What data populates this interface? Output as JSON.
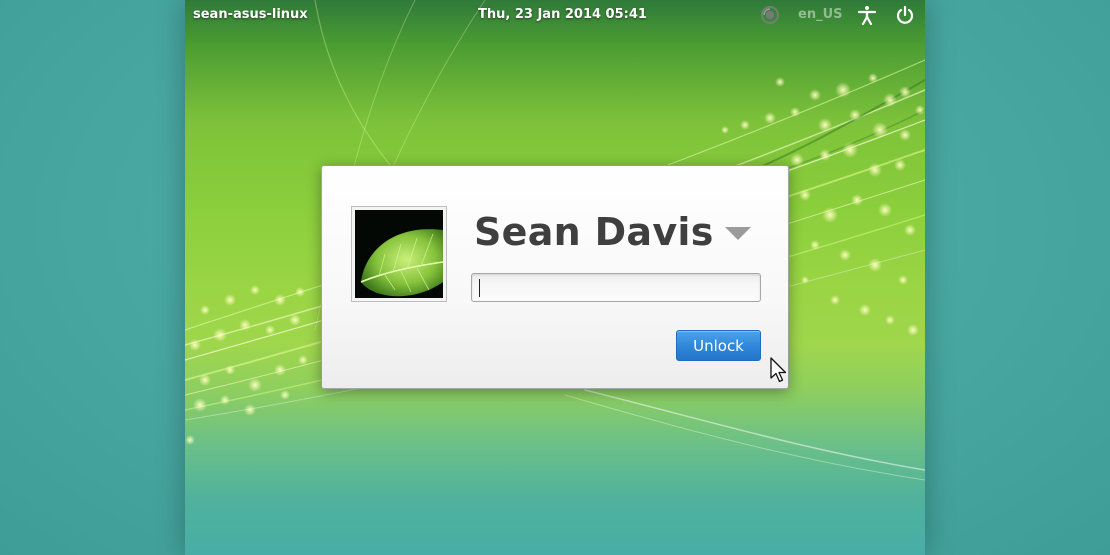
{
  "panel": {
    "hostname": "sean-asus-linux",
    "datetime": "Thu, 23 Jan 2014 05:41",
    "keyboard_layout": "en_US",
    "icons": [
      "network-icon",
      "accessibility-icon",
      "power-icon"
    ]
  },
  "dialog": {
    "user_name": "Sean Davis",
    "password_value": "",
    "unlock_label": "Unlock",
    "avatar": "leaf-photo"
  },
  "colors": {
    "accent": "#2f86d9",
    "name_text": "#3f3f3f",
    "outer_background": "#4aa9a4"
  }
}
